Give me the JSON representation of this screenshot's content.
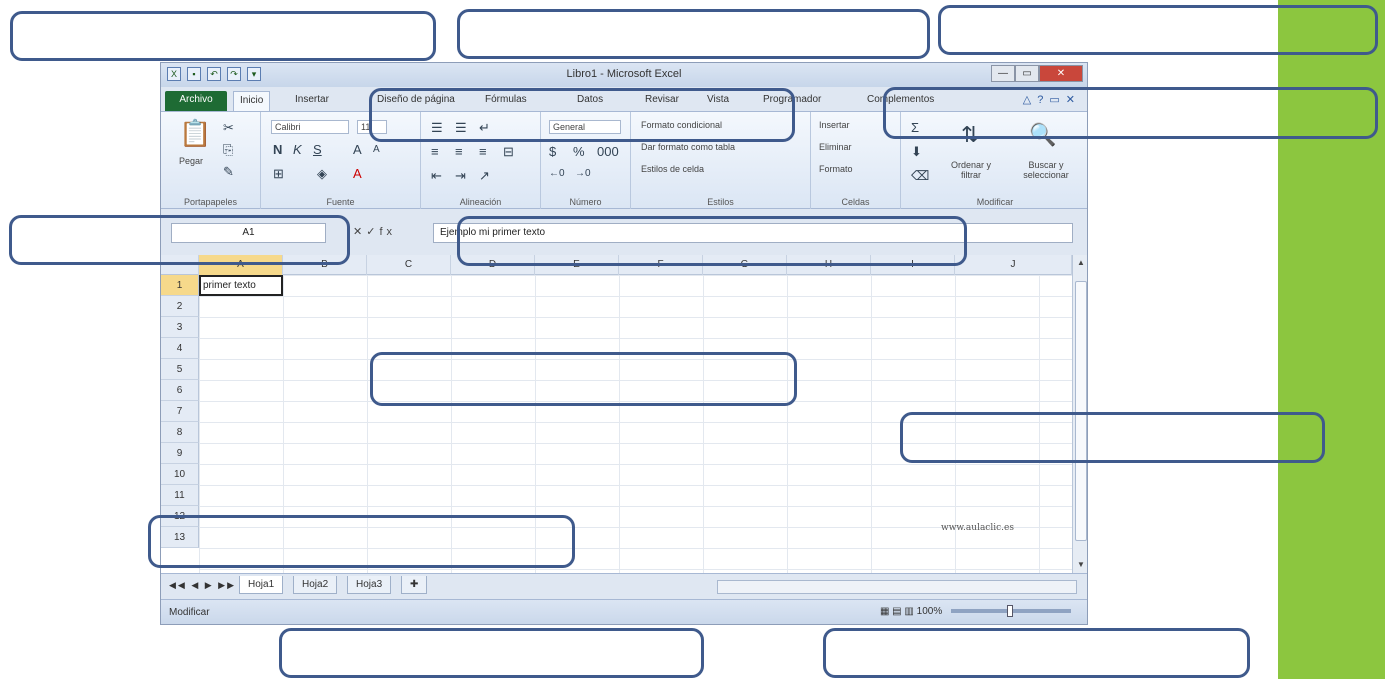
{
  "window": {
    "title": "Libro1 - Microsoft Excel"
  },
  "quick_access": {
    "icons": [
      "excel-logo-icon",
      "save-icon",
      "undo-icon",
      "redo-icon",
      "customize-icon"
    ]
  },
  "window_controls": {
    "minimize": "—",
    "maximize": "▭",
    "close": "✕"
  },
  "ribbon_tabs": [
    {
      "label": "Archivo"
    },
    {
      "label": "Inicio"
    },
    {
      "label": "Insertar"
    },
    {
      "label": "Diseño de página"
    },
    {
      "label": "Fórmulas"
    },
    {
      "label": "Datos"
    },
    {
      "label": "Revisar"
    },
    {
      "label": "Vista"
    },
    {
      "label": "Programador"
    },
    {
      "label": "Complementos"
    }
  ],
  "ribbon": {
    "clipboard": {
      "label": "Portapapeles",
      "paste": "Pegar"
    },
    "font": {
      "label": "Fuente",
      "font_name": "Calibri",
      "font_size": "11"
    },
    "alignment": {
      "label": "Alineación"
    },
    "number": {
      "label": "Número",
      "format": "General"
    },
    "styles": {
      "label": "Estilos",
      "conditional": "Formato condicional",
      "as_table": "Dar formato como tabla",
      "cell_styles": "Estilos de celda"
    },
    "cells": {
      "label": "Celdas",
      "insert": "Insertar",
      "delete": "Eliminar",
      "format": "Formato"
    },
    "editing": {
      "label": "Modificar",
      "sort": "Ordenar y filtrar",
      "find": "Buscar y seleccionar"
    }
  },
  "formula_bar": {
    "name_box": "A1",
    "content": "Ejemplo mi primer texto"
  },
  "columns": [
    "A",
    "B",
    "C",
    "D",
    "E",
    "F",
    "G",
    "H",
    "I",
    "J"
  ],
  "rows": [
    "1",
    "2",
    "3",
    "4",
    "5",
    "6",
    "7",
    "8",
    "9",
    "10",
    "11",
    "12",
    "13"
  ],
  "cells": {
    "A1": "primer texto"
  },
  "sheets": [
    {
      "label": "Hoja1"
    },
    {
      "label": "Hoja2"
    },
    {
      "label": "Hoja3"
    }
  ],
  "status": {
    "mode": "Modificar",
    "zoom": "100%"
  },
  "watermark": "www.aulaclic.es",
  "colors": {
    "accent": "#8cc63f",
    "callout_border": "#3f5a8c",
    "file_tab": "#1e6b34"
  }
}
